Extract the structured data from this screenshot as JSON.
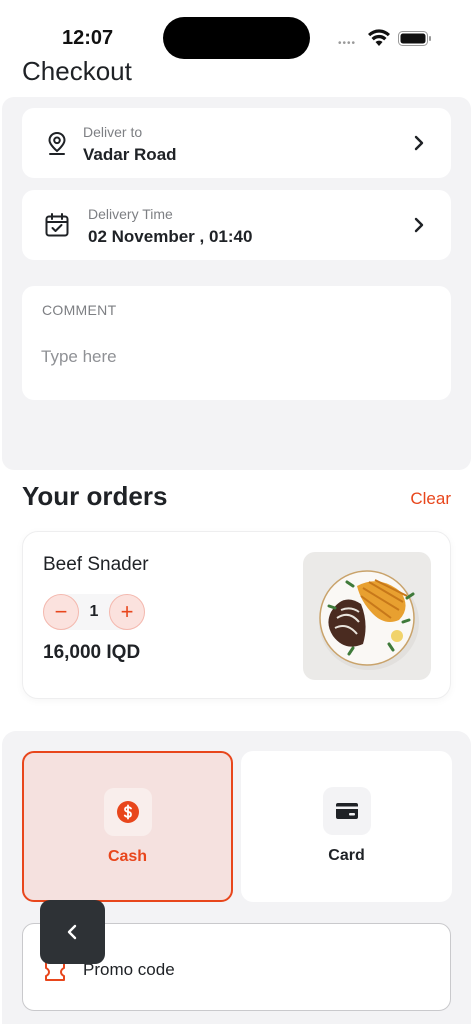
{
  "status_bar": {
    "time": "12:07",
    "signal": "••••"
  },
  "page": {
    "title": "Checkout"
  },
  "delivery": {
    "address_label": "Deliver to",
    "address_value": "Vadar Road",
    "time_label": "Delivery Time",
    "time_value": "02 November , 01:40"
  },
  "comment": {
    "label": "COMMENT",
    "placeholder": "Type here"
  },
  "orders": {
    "title": "Your orders",
    "clear_label": "Clear",
    "items": [
      {
        "name": "Beef Snader",
        "quantity": "1",
        "price": "16,000 IQD",
        "minus": "−",
        "plus": "+"
      }
    ]
  },
  "payment": {
    "selected": "Cash",
    "options": [
      {
        "label": "Cash",
        "icon": "dollar-coin-icon"
      },
      {
        "label": "Card",
        "icon": "credit-card-icon"
      }
    ]
  },
  "promo": {
    "label": "Promo code",
    "icon": "coupon-icon"
  },
  "colors": {
    "accent": "#e8461c",
    "panel": "#f3f3f5",
    "text": "#1f2226",
    "muted": "#7d7f83",
    "back_button": "#2e3236"
  }
}
